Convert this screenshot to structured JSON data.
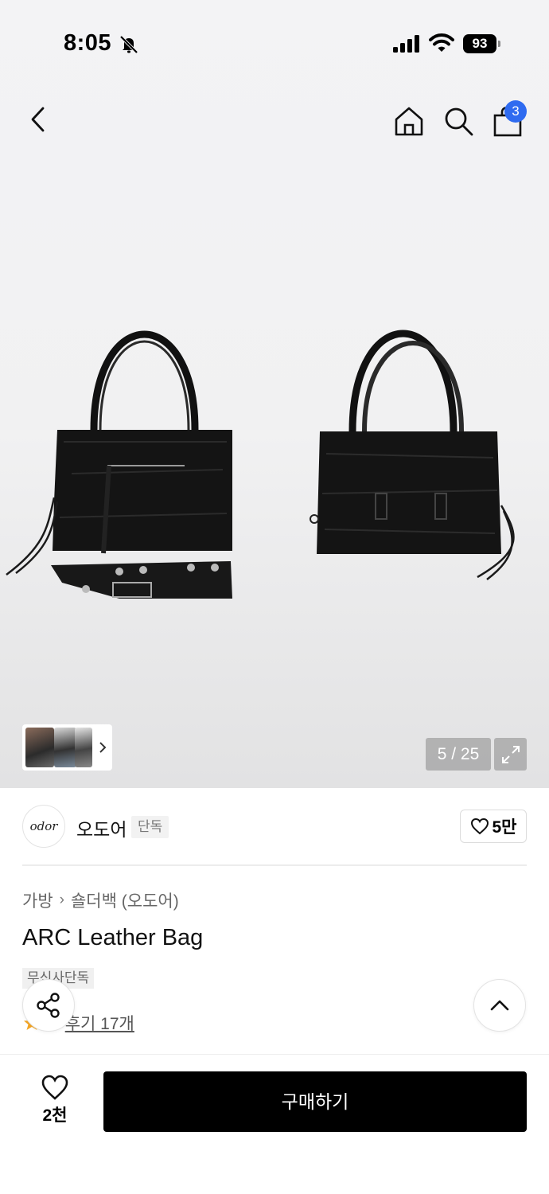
{
  "status_bar": {
    "time": "8:05",
    "battery": "93"
  },
  "nav": {
    "cart_count": "3"
  },
  "gallery": {
    "counter": "5 / 25"
  },
  "brand": {
    "logo_text": "odor",
    "name": "오도어",
    "badge": "단독",
    "like_count": "5만"
  },
  "breadcrumb": {
    "category": "가방",
    "subcategory": "숄더백 (오도어)"
  },
  "product": {
    "title": "ARC Leather Bag",
    "tag": "무신사단독",
    "rating": "5",
    "reviews_label": "후기 17개"
  },
  "bottom_bar": {
    "wish_count": "2천",
    "buy_label": "구매하기"
  },
  "colors": {
    "accent": "#2f6bf0",
    "buy_button": "#000000",
    "star": "#f5a623"
  },
  "icons": [
    "back-icon",
    "home-icon",
    "search-icon",
    "shopping-bag-icon",
    "chevron-right-icon",
    "expand-icon",
    "heart-icon",
    "share-icon",
    "chevron-up-icon",
    "star-icon",
    "bell-off-icon",
    "signal-icon",
    "wifi-icon"
  ]
}
